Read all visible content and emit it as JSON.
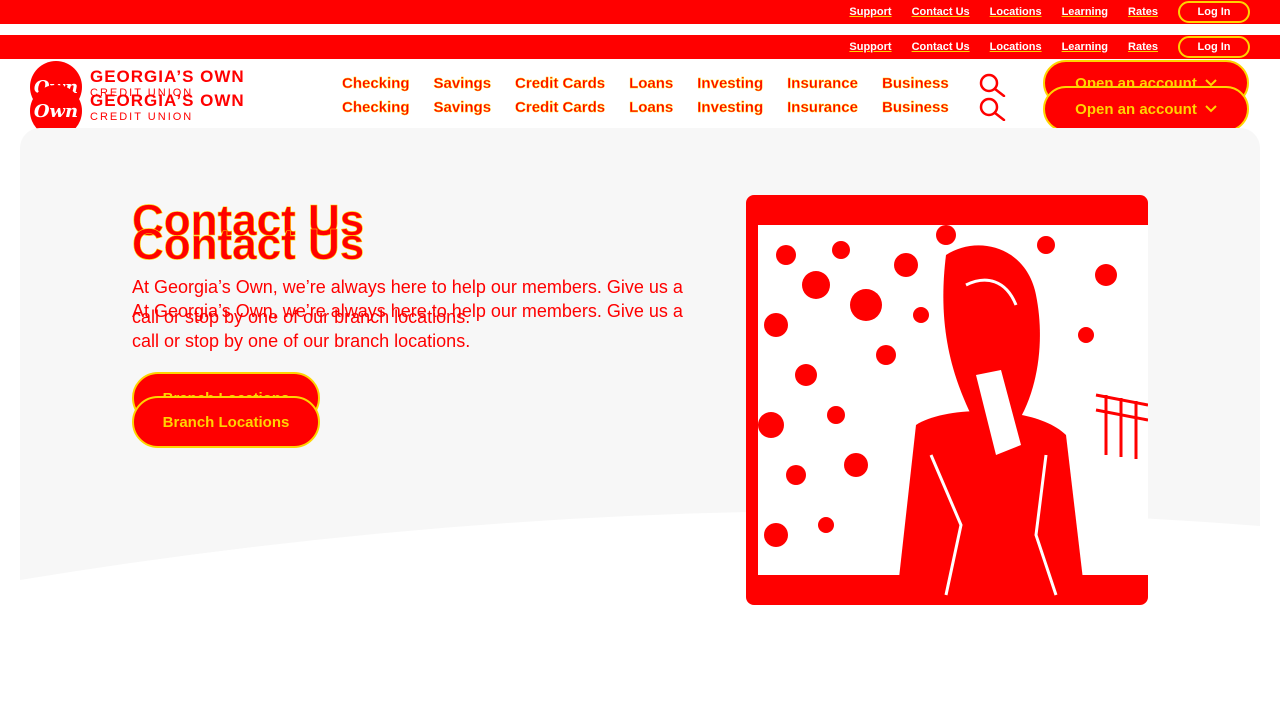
{
  "utility_nav": {
    "links": [
      "Support",
      "Contact Us",
      "Locations",
      "Learning",
      "Rates"
    ],
    "login_label": "Log In"
  },
  "brand": {
    "mark": "Own",
    "name": "GEORGIA’S OWN",
    "sub": "CREDIT UNION"
  },
  "main_nav": {
    "items": [
      "Checking",
      "Savings",
      "Credit Cards",
      "Loans",
      "Investing",
      "Insurance",
      "Business"
    ],
    "search_icon": "search-icon",
    "open_account_label": "Open an account",
    "open_account_icon": "chevron-down-icon"
  },
  "hero": {
    "title": "Contact Us",
    "description": "At Georgia’s Own, we’re always here to help our members. Give us a call or stop by one of our branch locations.",
    "button_label": "Branch Locations",
    "image": "woman-in-branch-photo"
  },
  "colors": {
    "primary": "#ff0000",
    "accent": "#ffd400",
    "panel": "#f7f7f7"
  }
}
